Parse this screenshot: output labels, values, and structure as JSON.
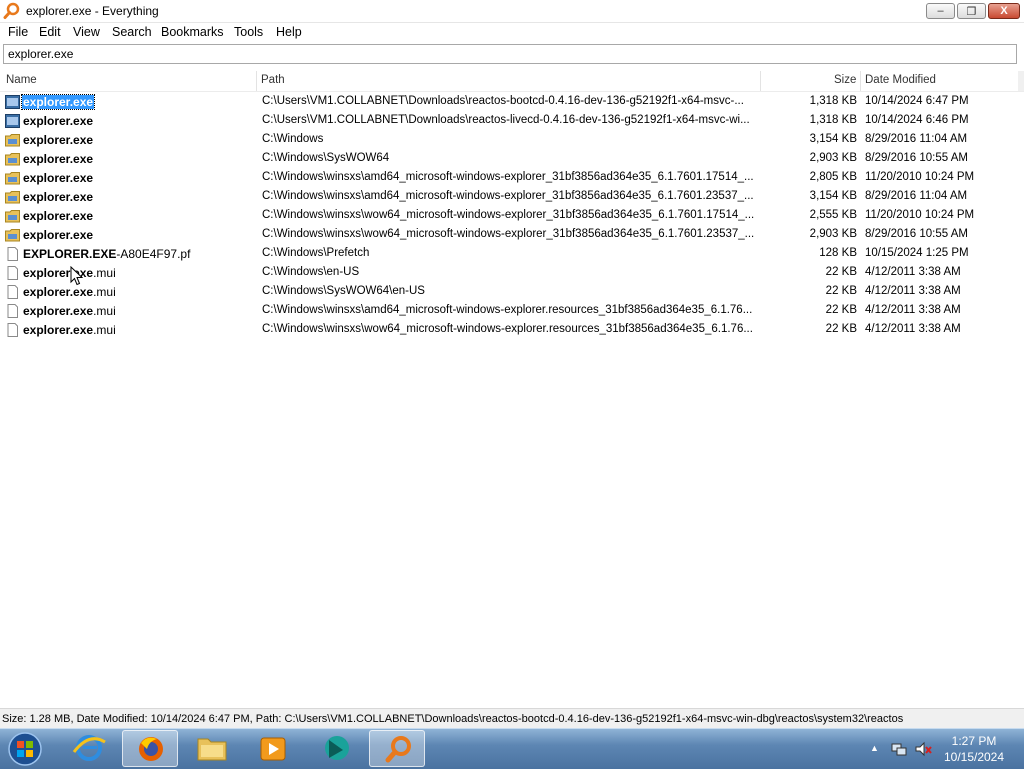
{
  "window": {
    "title": "explorer.exe - Everything",
    "min_glyph": "‒",
    "max_glyph": "❐",
    "close_glyph": "X"
  },
  "menu": [
    "File",
    "Edit",
    "View",
    "Search",
    "Bookmarks",
    "Tools",
    "Help"
  ],
  "search": {
    "value": "explorer.exe"
  },
  "columns": {
    "name": "Name",
    "path": "Path",
    "size": "Size",
    "date": "Date Modified"
  },
  "rows": [
    {
      "name_bold": "explorer.exe",
      "name_rest": "",
      "path": "C:\\Users\\VM1.COLLABNET\\Downloads\\reactos-bootcd-0.4.16-dev-136-g52192f1-x64-msvc-...",
      "size": "1,318 KB",
      "date": "10/14/2024 6:47 PM",
      "icon": "app-icon",
      "selected": true
    },
    {
      "name_bold": "explorer.exe",
      "name_rest": "",
      "path": "C:\\Users\\VM1.COLLABNET\\Downloads\\reactos-livecd-0.4.16-dev-136-g52192f1-x64-msvc-wi...",
      "size": "1,318 KB",
      "date": "10/14/2024 6:46 PM",
      "icon": "app-icon"
    },
    {
      "name_bold": "explorer.exe",
      "name_rest": "",
      "path": "C:\\Windows",
      "size": "3,154 KB",
      "date": "8/29/2016 11:04 AM",
      "icon": "folder-exe-icon"
    },
    {
      "name_bold": "explorer.exe",
      "name_rest": "",
      "path": "C:\\Windows\\SysWOW64",
      "size": "2,903 KB",
      "date": "8/29/2016 10:55 AM",
      "icon": "folder-exe-icon"
    },
    {
      "name_bold": "explorer.exe",
      "name_rest": "",
      "path": "C:\\Windows\\winsxs\\amd64_microsoft-windows-explorer_31bf3856ad364e35_6.1.7601.17514_...",
      "size": "2,805 KB",
      "date": "11/20/2010 10:24 PM",
      "icon": "folder-exe-icon"
    },
    {
      "name_bold": "explorer.exe",
      "name_rest": "",
      "path": "C:\\Windows\\winsxs\\amd64_microsoft-windows-explorer_31bf3856ad364e35_6.1.7601.23537_...",
      "size": "3,154 KB",
      "date": "8/29/2016 11:04 AM",
      "icon": "folder-exe-icon"
    },
    {
      "name_bold": "explorer.exe",
      "name_rest": "",
      "path": "C:\\Windows\\winsxs\\wow64_microsoft-windows-explorer_31bf3856ad364e35_6.1.7601.17514_...",
      "size": "2,555 KB",
      "date": "11/20/2010 10:24 PM",
      "icon": "folder-exe-icon"
    },
    {
      "name_bold": "explorer.exe",
      "name_rest": "",
      "path": "C:\\Windows\\winsxs\\wow64_microsoft-windows-explorer_31bf3856ad364e35_6.1.7601.23537_...",
      "size": "2,903 KB",
      "date": "8/29/2016 10:55 AM",
      "icon": "folder-exe-icon"
    },
    {
      "name_bold": "EXPLORER.EXE",
      "name_rest": "-A80E4F97.pf",
      "path": "C:\\Windows\\Prefetch",
      "size": "128 KB",
      "date": "10/15/2024 1:25 PM",
      "icon": "file-icon"
    },
    {
      "name_bold": "explorer.exe",
      "name_rest": ".mui",
      "path": "C:\\Windows\\en-US",
      "size": "22 KB",
      "date": "4/12/2011 3:38 AM",
      "icon": "file-icon"
    },
    {
      "name_bold": "explorer.exe",
      "name_rest": ".mui",
      "path": "C:\\Windows\\SysWOW64\\en-US",
      "size": "22 KB",
      "date": "4/12/2011 3:38 AM",
      "icon": "file-icon"
    },
    {
      "name_bold": "explorer.exe",
      "name_rest": ".mui",
      "path": "C:\\Windows\\winsxs\\amd64_microsoft-windows-explorer.resources_31bf3856ad364e35_6.1.76...",
      "size": "22 KB",
      "date": "4/12/2011 3:38 AM",
      "icon": "file-icon"
    },
    {
      "name_bold": "explorer.exe",
      "name_rest": ".mui",
      "path": "C:\\Windows\\winsxs\\wow64_microsoft-windows-explorer.resources_31bf3856ad364e35_6.1.76...",
      "size": "22 KB",
      "date": "4/12/2011 3:38 AM",
      "icon": "file-icon"
    }
  ],
  "status": "Size: 1.28 MB, Date Modified: 10/14/2024 6:47 PM, Path: C:\\Users\\VM1.COLLABNET\\Downloads\\reactos-bootcd-0.4.16-dev-136-g52192f1-x64-msvc-win-dbg\\reactos\\system32\\reactos",
  "taskbar": {
    "apps": [
      "start-orb-icon",
      "internet-explorer-icon",
      "firefox-icon",
      "file-explorer-icon",
      "media-player-icon",
      "bing-icon",
      "everything-search-icon"
    ],
    "active_app": "everything-search-icon",
    "tray_arrow": "▲",
    "tray": [
      "network-icon",
      "volume-muted-icon"
    ],
    "time": "1:27 PM",
    "date": "10/15/2024"
  },
  "colors": {
    "selection": "#3399ff",
    "taskbar": "#5d86b3",
    "close_button": "#c94a32",
    "folder": "#e8c15a"
  }
}
